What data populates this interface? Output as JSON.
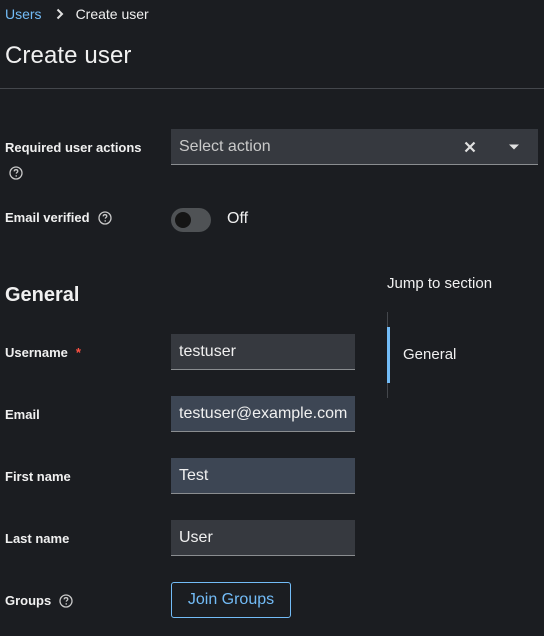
{
  "breadcrumb": {
    "parent": "Users",
    "current": "Create user"
  },
  "page_title": "Create user",
  "required_actions": {
    "label": "Required user actions",
    "placeholder": "Select action"
  },
  "email_verified": {
    "label": "Email verified",
    "state": "Off"
  },
  "section_title": "General",
  "fields": {
    "username": {
      "label": "Username",
      "required_mark": "*",
      "value": "testuser"
    },
    "email": {
      "label": "Email",
      "value": "testuser@example.com"
    },
    "first_name": {
      "label": "First name",
      "value": "Test"
    },
    "last_name": {
      "label": "Last name",
      "value": "User"
    }
  },
  "groups": {
    "label": "Groups",
    "button": "Join Groups"
  },
  "jump_to_section": {
    "title": "Jump to section",
    "items": [
      "General"
    ]
  },
  "colors": {
    "background": "#1b1d21",
    "accent": "#73bcf7",
    "input_bg": "#36393f",
    "required": "#fe5142"
  },
  "icons": [
    "chevron-right-icon",
    "help-icon",
    "close-icon",
    "caret-down-icon"
  ]
}
